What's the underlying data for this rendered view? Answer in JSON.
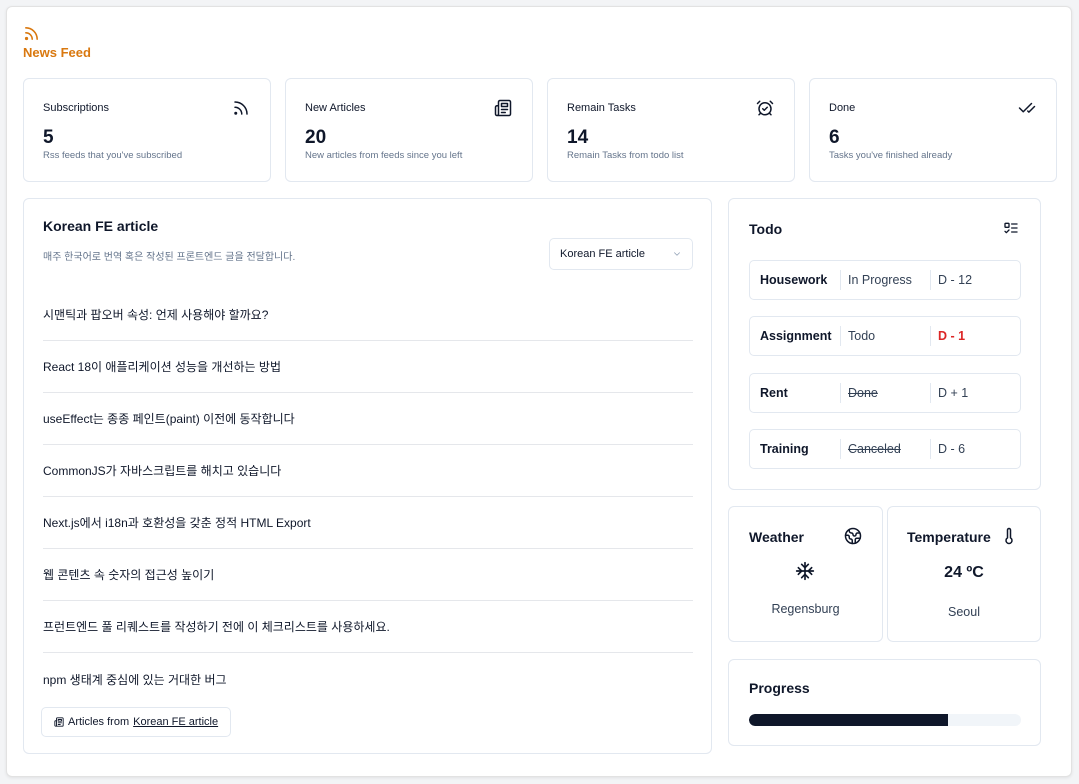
{
  "app": {
    "title": "News Feed",
    "accent": "#d9780f"
  },
  "stats": [
    {
      "label": "Subscriptions",
      "value": "5",
      "desc": "Rss feeds that you've subscribed",
      "icon": "rss-icon"
    },
    {
      "label": "New Articles",
      "value": "20",
      "desc": "New articles from feeds since you left",
      "icon": "newspaper-icon"
    },
    {
      "label": "Remain Tasks",
      "value": "14",
      "desc": "Remain Tasks from todo list",
      "icon": "alarm-clock-icon"
    },
    {
      "label": "Done",
      "value": "6",
      "desc": "Tasks you've finished already",
      "icon": "double-check-icon"
    }
  ],
  "feed": {
    "title": "Korean FE article",
    "description": "매주 한국어로 번역 혹은 작성된 프론트엔드 글을 전달합니다.",
    "selected_feed": "Korean FE article",
    "articles": [
      "시맨틱과 팝오버 속성: 언제 사용해야 할까요?",
      "React 18이 애플리케이션 성능을 개선하는 방법",
      "useEffect는 종종 페인트(paint) 이전에 동작합니다",
      "CommonJS가 자바스크립트를 해치고 있습니다",
      "Next.js에서 i18n과 호환성을 갖춘 정적 HTML Export",
      "웹 콘텐츠 속 숫자의 접근성 높이기",
      "프런트엔드 풀 리퀘스트를 작성하기 전에 이 체크리스트를 사용하세요.",
      "npm 생태계 중심에 있는 거대한 버그"
    ],
    "footer_prefix": "Articles from",
    "footer_link": "Korean FE article"
  },
  "todo": {
    "title": "Todo",
    "items": [
      {
        "name": "Housework",
        "status": "In Progress",
        "due": "D - 12",
        "struck": false,
        "urgent": false
      },
      {
        "name": "Assignment",
        "status": "Todo",
        "due": "D - 1",
        "struck": false,
        "urgent": true
      },
      {
        "name": "Rent",
        "status": "Done",
        "due": "D + 1",
        "struck": true,
        "urgent": false
      },
      {
        "name": "Training",
        "status": "Canceled",
        "due": "D - 6",
        "struck": true,
        "urgent": false
      }
    ]
  },
  "weather": {
    "title": "Weather",
    "city": "Regensburg",
    "condition_icon": "snowflake-icon"
  },
  "temperature": {
    "title": "Temperature",
    "value": "24 ºC",
    "city": "Seoul"
  },
  "progress": {
    "title": "Progress",
    "value": 0.73
  }
}
